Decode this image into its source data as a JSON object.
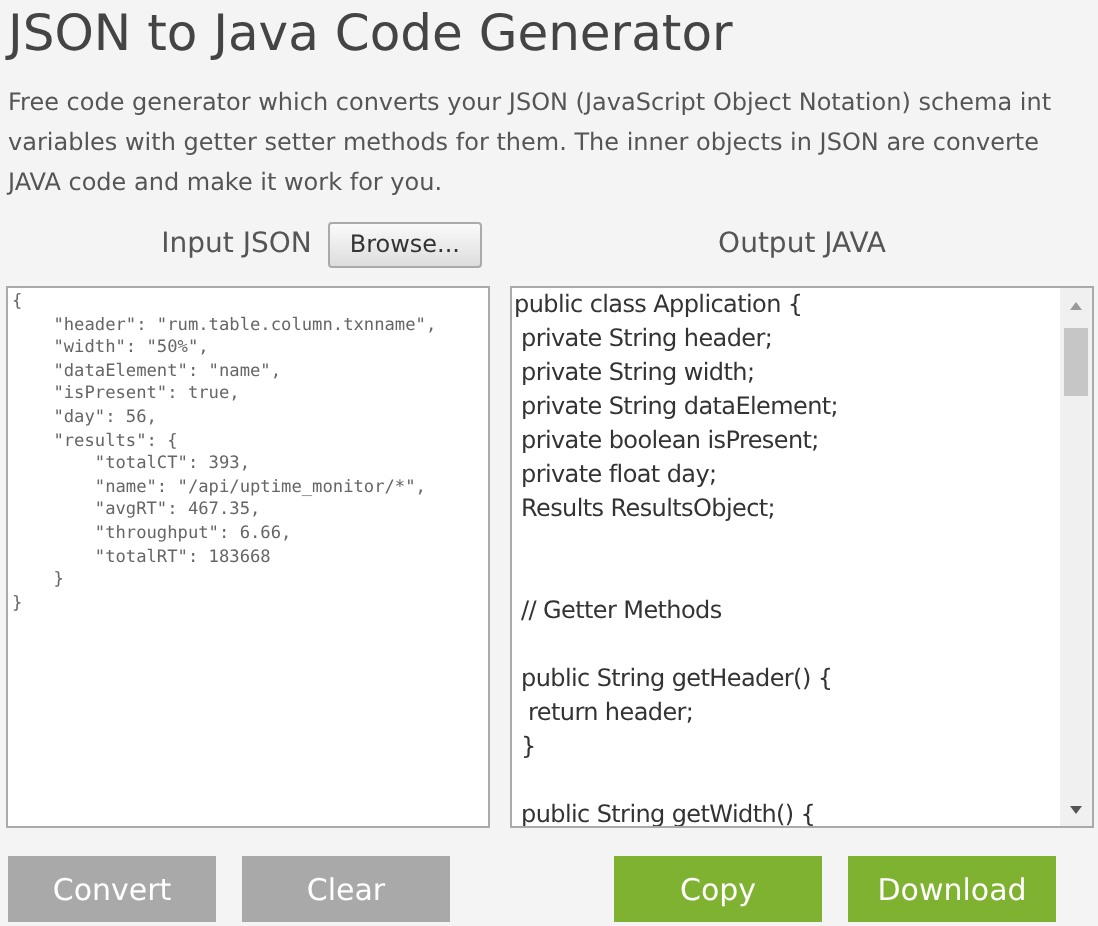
{
  "title": "JSON to Java Code Generator",
  "description": [
    "Free code generator which converts your JSON (JavaScript Object Notation) schema int",
    "variables with getter setter methods for them. The inner objects in JSON are converte",
    "JAVA code and make it work for you."
  ],
  "input": {
    "label": "Input JSON",
    "browse_button": "Browse...",
    "code": "{\n    \"header\": \"rum.table.column.txnname\",\n    \"width\": \"50%\",\n    \"dataElement\": \"name\",\n    \"isPresent\": true,\n    \"day\": 56,\n    \"results\": {\n        \"totalCT\": 393,\n        \"name\": \"/api/uptime_monitor/*\",\n        \"avgRT\": 467.35,\n        \"throughput\": 6.66,\n        \"totalRT\": 183668\n    }\n}"
  },
  "output": {
    "label": "Output JAVA",
    "code": "public class Application {\n private String header;\n private String width;\n private String dataElement;\n private boolean isPresent;\n private float day;\n Results ResultsObject;\n\n\n // Getter Methods\n\n public String getHeader() {\n  return header;\n }\n\n public String getWidth() {"
  },
  "buttons": [
    {
      "label": "Convert",
      "kind": "secondary"
    },
    {
      "label": "Clear",
      "kind": "secondary"
    },
    {
      "label": "Copy",
      "kind": "primary"
    },
    {
      "label": "Download",
      "kind": "primary"
    }
  ]
}
